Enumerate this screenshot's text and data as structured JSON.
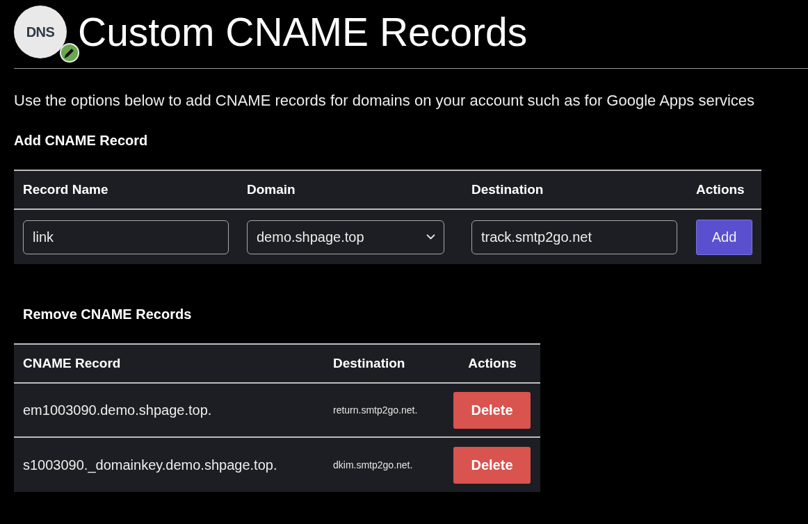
{
  "header": {
    "logo_text": "DNS",
    "title": "Custom CNAME Records"
  },
  "intro": "Use the options below to add CNAME records for domains on your account such as for Google Apps services",
  "add_section": {
    "heading": "Add CNAME Record",
    "table": {
      "columns": [
        "Record Name",
        "Domain",
        "Destination",
        "Actions"
      ],
      "row": {
        "record_name": "link",
        "domain": "demo.shpage.top",
        "destination": "track.smtp2go.net",
        "action": "Add"
      }
    }
  },
  "remove_section": {
    "heading": "Remove CNAME Records",
    "table": {
      "columns": [
        "CNAME Record",
        "Destination",
        "Actions"
      ],
      "rows": [
        {
          "record": "em1003090.demo.shpage.top.",
          "destination": "return.smtp2go.net.",
          "action": "Delete"
        },
        {
          "record": "s1003090._domainkey.demo.shpage.top.",
          "destination": "dkim.smtp2go.net.",
          "action": "Delete"
        }
      ]
    }
  }
}
